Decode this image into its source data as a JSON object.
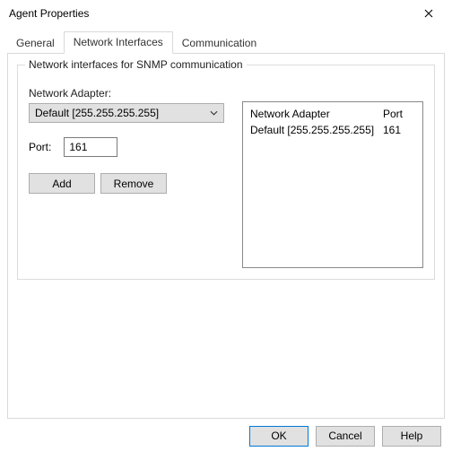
{
  "window": {
    "title": "Agent Properties"
  },
  "tabs": {
    "general": "General",
    "network_interfaces": "Network Interfaces",
    "communication": "Communication",
    "active": "network_interfaces"
  },
  "group": {
    "title": "Network interfaces for SNMP communication"
  },
  "form": {
    "adapter_label": "Network Adapter:",
    "adapter_value": "Default [255.255.255.255]",
    "port_label": "Port:",
    "port_value": "161",
    "add_label": "Add",
    "remove_label": "Remove"
  },
  "list": {
    "header_adapter": "Network Adapter",
    "header_port": "Port",
    "rows": [
      {
        "adapter": "Default [255.255.255.255]",
        "port": "161"
      }
    ]
  },
  "footer": {
    "ok": "OK",
    "cancel": "Cancel",
    "help": "Help"
  }
}
